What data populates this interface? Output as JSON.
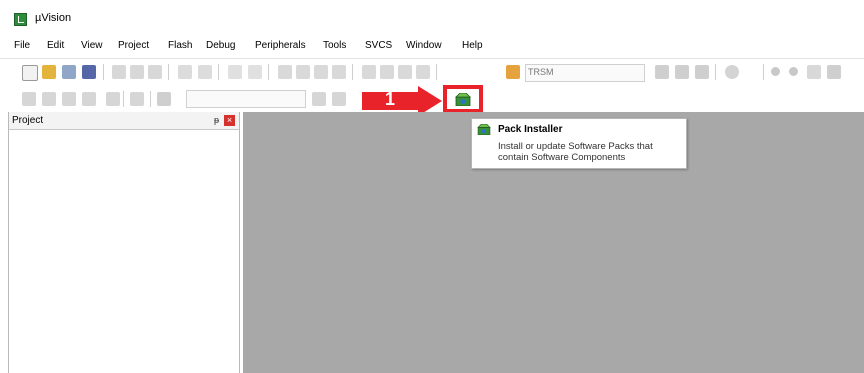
{
  "window": {
    "title": "µVision"
  },
  "menu": [
    "File",
    "Edit",
    "View",
    "Project",
    "Flash",
    "Debug",
    "Peripherals",
    "Tools",
    "SVCS",
    "Window",
    "Help"
  ],
  "toolbar": {
    "target_combo": "TRSM"
  },
  "project_panel": {
    "title": "Project",
    "pin_glyph": "ᵽ",
    "close_glyph": "×"
  },
  "annotation": {
    "step_number": "1",
    "color": "#e8232a"
  },
  "tooltip": {
    "title": "Pack Installer",
    "description": "Install or update Software Packs that contain Software Components"
  },
  "icons": {
    "pack_installer": "pack-installer-icon",
    "app": "uvision-app-icon"
  }
}
